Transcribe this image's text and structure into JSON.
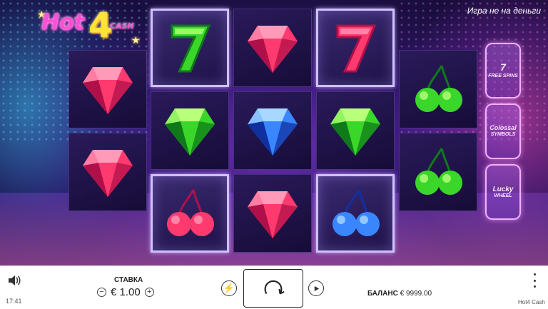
{
  "logo": {
    "word": "Hot",
    "number": "4",
    "tag": "CASH"
  },
  "demo_label": "Игра не на деньги",
  "reels": [
    [
      null,
      "gem-red",
      "gem-red",
      null
    ],
    [
      "seven-green",
      "gem-green",
      "cherry-red"
    ],
    [
      "gem-red",
      "gem-blue",
      "gem-red"
    ],
    [
      "seven-red",
      "gem-green",
      "cherry-blue"
    ],
    [
      null,
      "cherry-green",
      "cherry-green",
      null
    ]
  ],
  "side_buttons": [
    {
      "big": "7",
      "label": "FREE SPINS"
    },
    {
      "big": "Colossal",
      "label": "SYMBOLS"
    },
    {
      "big": "Lucky",
      "label": "WHEEL"
    }
  ],
  "bottom": {
    "clock": "17:41",
    "stake_title": "СТАВКА",
    "minus": "−",
    "stake_value": "€ 1.00",
    "plus": "+",
    "balance_label": "БАЛАНС",
    "balance_value": "€ 9999.00",
    "game_name": "Hot4 Cash"
  }
}
